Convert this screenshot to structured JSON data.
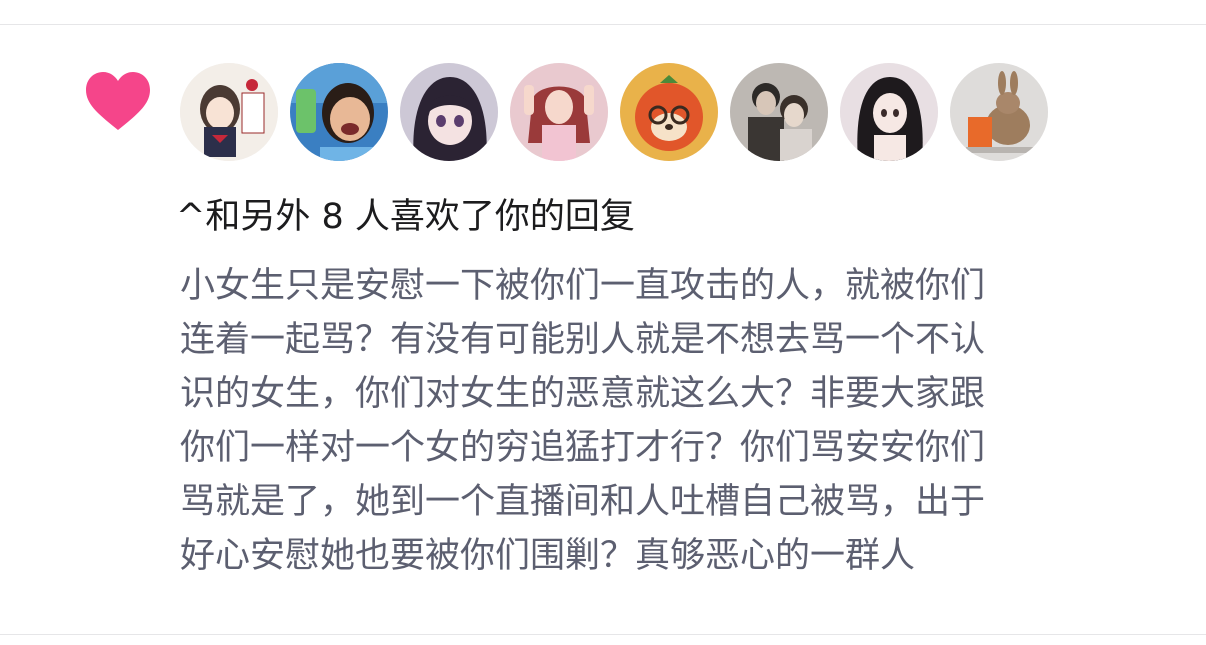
{
  "notification": {
    "icon": "heart-icon",
    "heart_color": "#f5458a",
    "avatars": [
      {
        "name": "avatar-anime-girl-sticker",
        "bg": "#f3eee8"
      },
      {
        "name": "avatar-laughing-woman",
        "bg": "#3a7fc2"
      },
      {
        "name": "avatar-anime-dark-hair",
        "bg": "#cdc8d6"
      },
      {
        "name": "avatar-girl-pink",
        "bg": "#e9c9cf"
      },
      {
        "name": "avatar-orange-bear",
        "bg": "#d85a2a"
      },
      {
        "name": "avatar-couple-photo",
        "bg": "#bdb8b3"
      },
      {
        "name": "avatar-doll-girl",
        "bg": "#e8dfe3"
      },
      {
        "name": "avatar-rabbit",
        "bg": "#dedcda"
      }
    ],
    "summary": "^和另外 8 人喜欢了你的回复",
    "comment_lines": [
      "小女生只是安慰一下被你们一直攻击的人，就被你们",
      "连着一起骂？有没有可能别人就是不想去骂一个不认",
      "识的女生，你们对女生的恶意就这么大？非要大家跟",
      "你们一样对一个女的穷追猛打才行？你们骂安安你们",
      "骂就是了，她到一个直播间和人吐槽自己被骂，出于",
      "好心安慰她也要被你们围剿？真够恶心的一群人"
    ]
  }
}
